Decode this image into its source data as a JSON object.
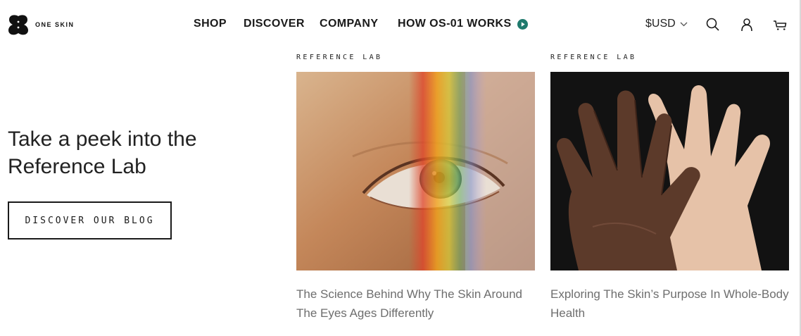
{
  "brand": {
    "name": "ONE SKIN"
  },
  "nav": {
    "shop": "SHOP",
    "discover": "DISCOVER",
    "company": "COMPANY",
    "how": "HOW OS-01 WORKS"
  },
  "header": {
    "currency": "$USD"
  },
  "hero": {
    "title": "Take a peek into the Reference Lab",
    "button": "DISCOVER OUR BLOG"
  },
  "cards": [
    {
      "tag": "REFERENCE LAB",
      "image": "eye-with-rainbow-light-photo",
      "title": "The Science Behind Why The Skin Around The Eyes Ages Differently"
    },
    {
      "tag": "REFERENCE LAB",
      "image": "overlapping-hands-photo",
      "title": "Exploring The Skin’s Purpose In Whole-Body Health"
    }
  ],
  "colors": {
    "accent": "#1f7a6d",
    "text": "#1f1f1f",
    "muted": "#6e6e6e"
  }
}
